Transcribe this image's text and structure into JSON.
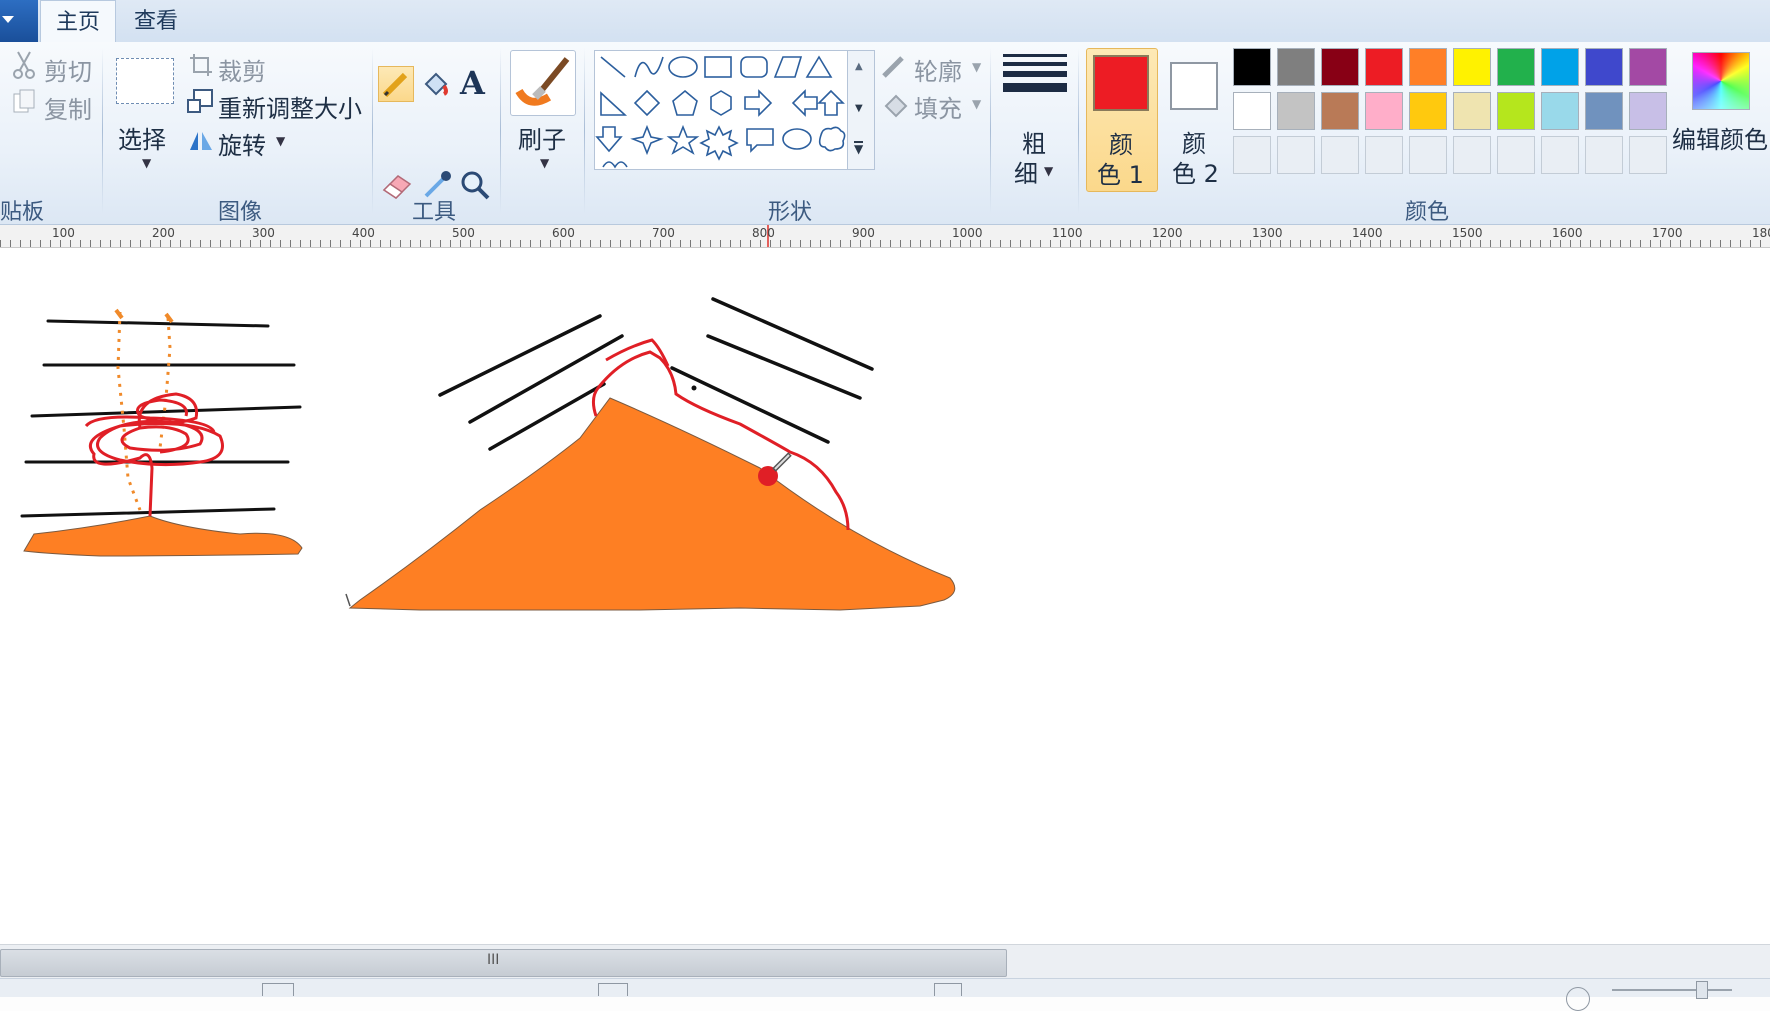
{
  "tabs": {
    "home": "主页",
    "view": "查看"
  },
  "clipboard": {
    "cut": "剪切",
    "copy": "复制",
    "label": "贴板"
  },
  "image": {
    "select": "选择",
    "crop": "裁剪",
    "resize": "重新调整大小",
    "rotate": "旋转",
    "label": "图像"
  },
  "tools": {
    "label": "工具",
    "text_tool": "A"
  },
  "brushes": {
    "label": "刷子"
  },
  "shapes": {
    "outline": "轮廓",
    "fill": "填充",
    "label": "形状"
  },
  "size": {
    "line1": "粗",
    "line2": "细"
  },
  "colors": {
    "color1_line1": "颜",
    "color1_line2": "色 1",
    "color2_line1": "颜",
    "color2_line2": "色 2",
    "edit": "编辑颜色",
    "label": "颜色",
    "color1_value": "#ed1c24",
    "color2_value": "#ffffff",
    "palette_row1": [
      "#000000",
      "#7f7f7f",
      "#880015",
      "#ed1c24",
      "#ff7f27",
      "#fff200",
      "#22b14c",
      "#00a2e8",
      "#3f48cc",
      "#a349a4"
    ],
    "palette_row2": [
      "#ffffff",
      "#c3c3c3",
      "#b97a57",
      "#ffaec9",
      "#ffc90e",
      "#efe4b0",
      "#b5e61d",
      "#99d9ea",
      "#7092be",
      "#c8bfe7"
    ],
    "palette_row3": [
      "",
      "",
      "",
      "",
      "",
      "",
      "",
      "",
      "",
      ""
    ]
  },
  "ruler": {
    "ticks": [
      "100",
      "200",
      "300",
      "400",
      "500",
      "600",
      "700",
      "800",
      "900",
      "1000",
      "1100",
      "1200",
      "1300",
      "1400",
      "1500",
      "1600",
      "1700",
      "180"
    ]
  },
  "scroll": {
    "grip": "III"
  }
}
